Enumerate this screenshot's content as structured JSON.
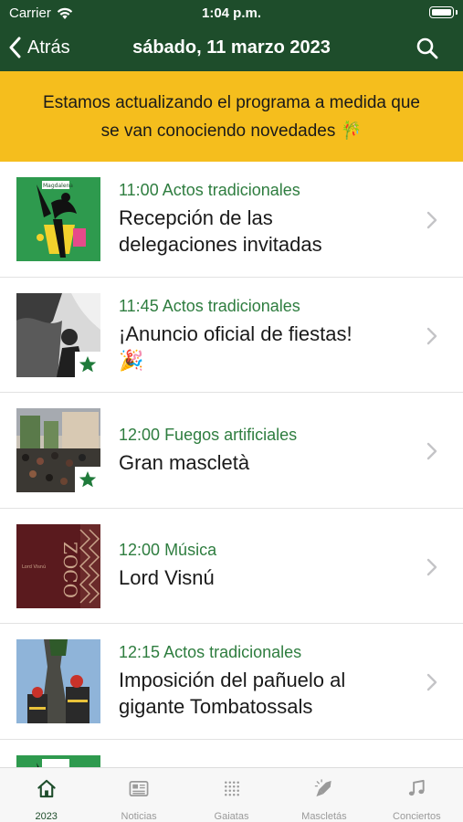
{
  "status": {
    "carrier": "Carrier",
    "time": "1:04 p.m."
  },
  "nav": {
    "back_label": "Atrás",
    "title": "sábado, 11 marzo 2023"
  },
  "banner": {
    "line1": "Estamos actualizando el programa a medida que",
    "line2": "se van conociendo novedades 🎋"
  },
  "events": [
    {
      "time": "11:00",
      "category": "Actos tradicionales",
      "title_line1": "Recepción de las",
      "title_line2": "delegaciones invitadas",
      "favorite": false,
      "thumb_logo": "Magdalena"
    },
    {
      "time": "11:45",
      "category": "Actos tradicionales",
      "title_line1": "¡Anuncio oficial de fiestas!",
      "title_line2": "🎉",
      "favorite": true
    },
    {
      "time": "12:00",
      "category": "Fuegos artificiales",
      "title_line1": "Gran mascletà",
      "title_line2": "",
      "favorite": true
    },
    {
      "time": "12:00",
      "category": "Música",
      "title_line1": "Lord Visnú",
      "title_line2": "",
      "favorite": false,
      "thumb_text": "ZOCO",
      "thumb_small": "Lord Visnú"
    },
    {
      "time": "12:15",
      "category": "Actos tradicionales",
      "title_line1": "Imposición del pañuelo al",
      "title_line2": "gigante Tombatossals",
      "favorite": false
    }
  ],
  "tabs": [
    {
      "label": "2023",
      "icon": "home-icon",
      "active": true
    },
    {
      "label": "Noticias",
      "icon": "news-icon",
      "active": false
    },
    {
      "label": "Gaiatas",
      "icon": "dots-grid-icon",
      "active": false
    },
    {
      "label": "Mascletás",
      "icon": "rocket-icon",
      "active": false
    },
    {
      "label": "Conciertos",
      "icon": "music-note-icon",
      "active": false
    }
  ],
  "colors": {
    "header": "#1e4d2b",
    "banner": "#f5be1d",
    "accent_green": "#2e7d3f",
    "tab_inactive": "#9a9a9a"
  }
}
